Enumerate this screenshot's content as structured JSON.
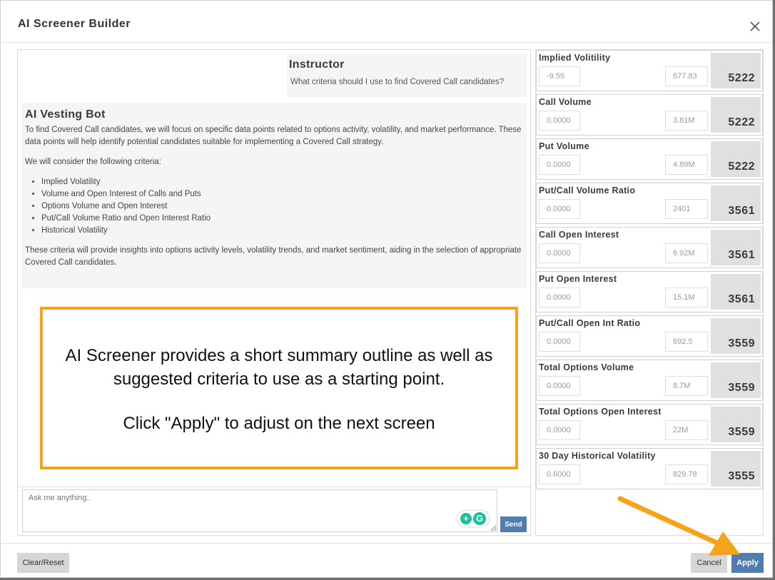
{
  "modal": {
    "title": "AI Screener Builder"
  },
  "chat": {
    "instructor": {
      "name": "Instructor",
      "question": "What criteria should I use to find Covered Call candidates?"
    },
    "bot": {
      "name": "AI Vesting Bot",
      "intro": "To find Covered Call candidates, we will focus on specific data points related to options activity, volatility, and market performance. These data points will help identify potential candidates suitable for implementing a Covered Call strategy.",
      "lead": "We will consider the following criteria:",
      "criteria": [
        "Implied Volatility",
        "Volume and Open Interest of Calls and Puts",
        "Options Volume and Open Interest",
        "Put/Call Volume Ratio and Open Interest Ratio",
        "Historical Volatility"
      ],
      "closing": "These criteria will provide insights into options activity levels, volatility trends, and market sentiment, aiding in the selection of appropriate Covered Call candidates."
    },
    "input_placeholder": "Ask me anything..",
    "send_label": "Send"
  },
  "callout": {
    "line1": "AI Screener provides a short summary outline as well as suggested criteria to use as a starting point.",
    "line2": "Click \"Apply\" to adjust on the next screen",
    "border_color": "#f5a31a"
  },
  "criteria": [
    {
      "label": "Implied Volitility",
      "min": "-9.55",
      "max": "577.83",
      "count": "5222"
    },
    {
      "label": "Call Volume",
      "min": "0.0000",
      "max": "3.81M",
      "count": "5222"
    },
    {
      "label": "Put Volume",
      "min": "0.0000",
      "max": "4.89M",
      "count": "5222"
    },
    {
      "label": "Put/Call Volume Ratio",
      "min": "0.0000",
      "max": "2401",
      "count": "3561"
    },
    {
      "label": "Call Open Interest",
      "min": "0.0000",
      "max": "6.92M",
      "count": "3561"
    },
    {
      "label": "Put Open Interest",
      "min": "0.0000",
      "max": "15.1M",
      "count": "3561"
    },
    {
      "label": "Put/Call Open Int Ratio",
      "min": "0.0000",
      "max": "692.5",
      "count": "3559"
    },
    {
      "label": "Total Options Volume",
      "min": "0.0000",
      "max": "8.7M",
      "count": "3559"
    },
    {
      "label": "Total Options Open Interest",
      "min": "0.0000",
      "max": "22M",
      "count": "3559"
    },
    {
      "label": "30 Day Historical Volatility",
      "min": "0.6000",
      "max": "829.78",
      "count": "3555"
    }
  ],
  "footer": {
    "clear_label": "Clear/Reset",
    "cancel_label": "Cancel",
    "apply_label": "Apply"
  },
  "colors": {
    "primary": "#4f7db0",
    "accent": "#f5a31a",
    "count_bg": "#e0e0e0"
  },
  "icons": {
    "close": "close-icon",
    "grammarly": "grammarly-icon",
    "arrow": "pointer-arrow-icon"
  }
}
